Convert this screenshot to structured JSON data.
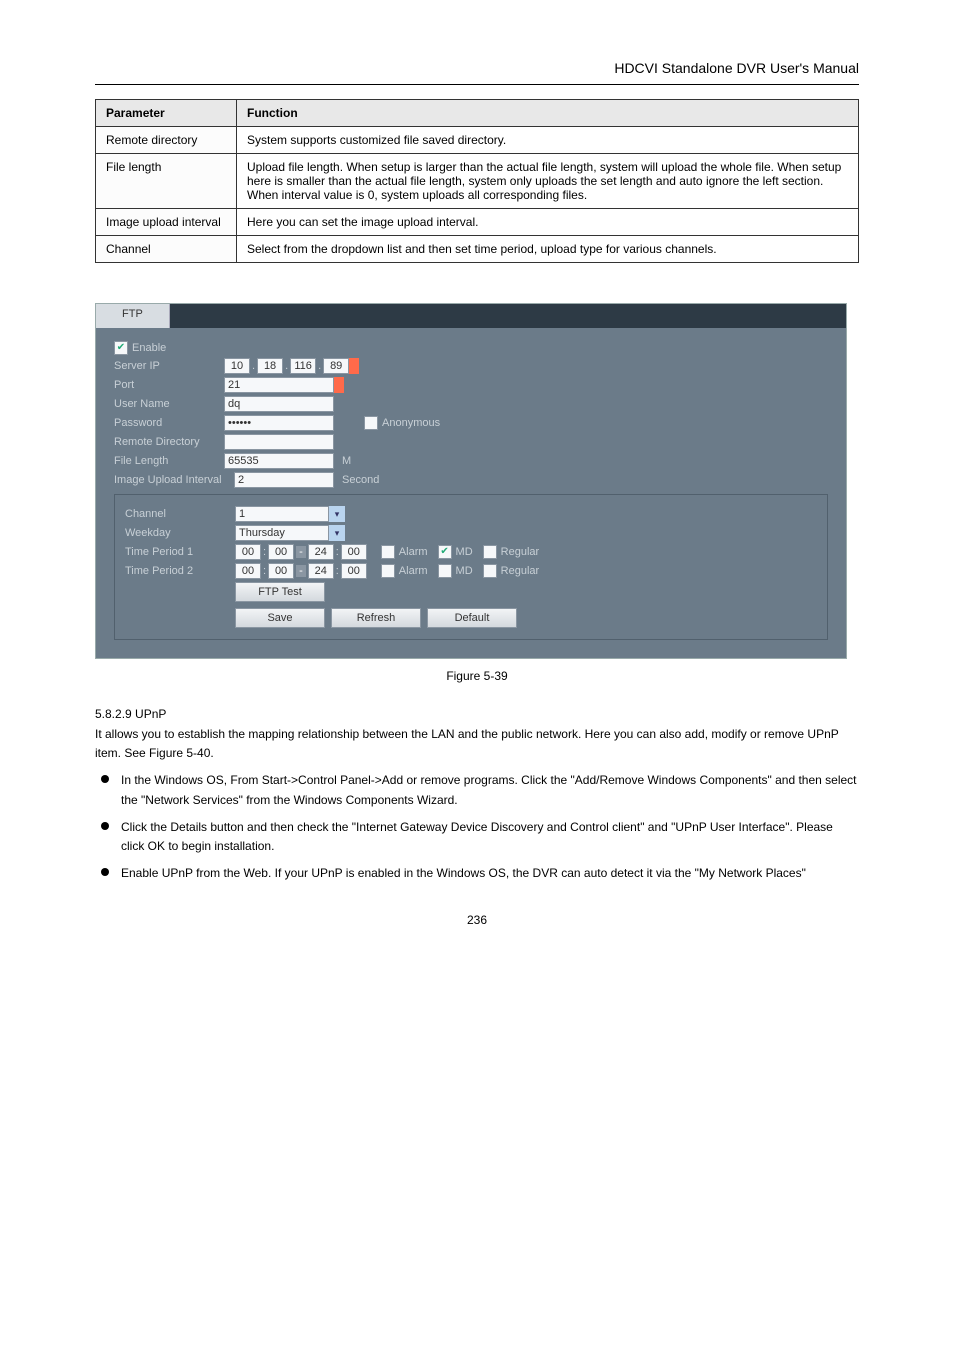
{
  "header": {
    "title": "HDCVI Standalone DVR User's Manual"
  },
  "param_table": {
    "headers": [
      "Parameter",
      "Function"
    ],
    "rows": [
      [
        "Remote directory",
        "System supports customized file saved directory."
      ],
      [
        "File length",
        "Upload file length. When setup is larger than the actual file length, system will upload the whole file. When setup here is smaller than the actual file length, system only uploads the set length and auto ignore the left section. When interval value is 0, system uploads all corresponding files."
      ],
      [
        "Image upload interval",
        "Here you can set the image upload interval."
      ],
      [
        "Channel",
        "Select from the dropdown list and then set time period, upload type for various channels."
      ]
    ]
  },
  "ftp_panel": {
    "tab": "FTP",
    "enable_label": "Enable",
    "enable_checked": true,
    "server_ip_label": "Server IP",
    "ip": [
      "10",
      "18",
      "116",
      "89"
    ],
    "ip_trail": "*",
    "port_label": "Port",
    "port_value": "21",
    "port_star": "*",
    "user_label": "User Name",
    "user_value": "dq",
    "pass_label": "Password",
    "pass_value": "••••••",
    "anon_label": "Anonymous",
    "anon_checked": false,
    "remote_label": "Remote Directory",
    "remote_value": "",
    "filelen_label": "File Length",
    "filelen_value": "65535",
    "filelen_unit": "M",
    "imgint_label": "Image Upload Interval",
    "imgint_value": "2",
    "imgint_unit": "Second",
    "channel_label": "Channel",
    "channel_value": "1",
    "weekday_label": "Weekday",
    "weekday_value": "Thursday",
    "tp1_label": "Time Period 1",
    "tp1_start_h": "00",
    "tp1_start_m": "00",
    "tp1_end_h": "24",
    "tp1_end_m": "00",
    "tp1_alarm": false,
    "tp1_md": true,
    "tp1_regular": false,
    "tp2_label": "Time Period 2",
    "tp2_start_h": "00",
    "tp2_start_m": "00",
    "tp2_end_h": "24",
    "tp2_end_m": "00",
    "tp2_alarm": false,
    "tp2_md": false,
    "tp2_regular": false,
    "alarm_label": "Alarm",
    "md_label": "MD",
    "regular_label": "Regular",
    "ftptest_btn": "FTP Test",
    "save_btn": "Save",
    "refresh_btn": "Refresh",
    "default_btn": "Default"
  },
  "figure_caption": "Figure 5-39",
  "upnp_section": {
    "heading": "5.8.2.9 UPnP",
    "intro": "It allows you to establish the mapping relationship between the LAN and the public network. Here you can also add, modify or remove UPnP item. See Figure 5-40.",
    "bullets": [
      "In the Windows OS, From Start->Control Panel->Add or remove programs. Click the \"Add/Remove Windows Components\" and then select the \"Network Services\" from the Windows Components Wizard.",
      "Click the Details button and then check the \"Internet Gateway Device Discovery and Control client\" and \"UPnP User Interface\". Please click OK to begin installation.",
      "Enable UPnP from the Web. If your UPnP is enabled in the Windows OS, the DVR can auto detect it via the \"My Network Places\""
    ]
  },
  "page_number": "236"
}
